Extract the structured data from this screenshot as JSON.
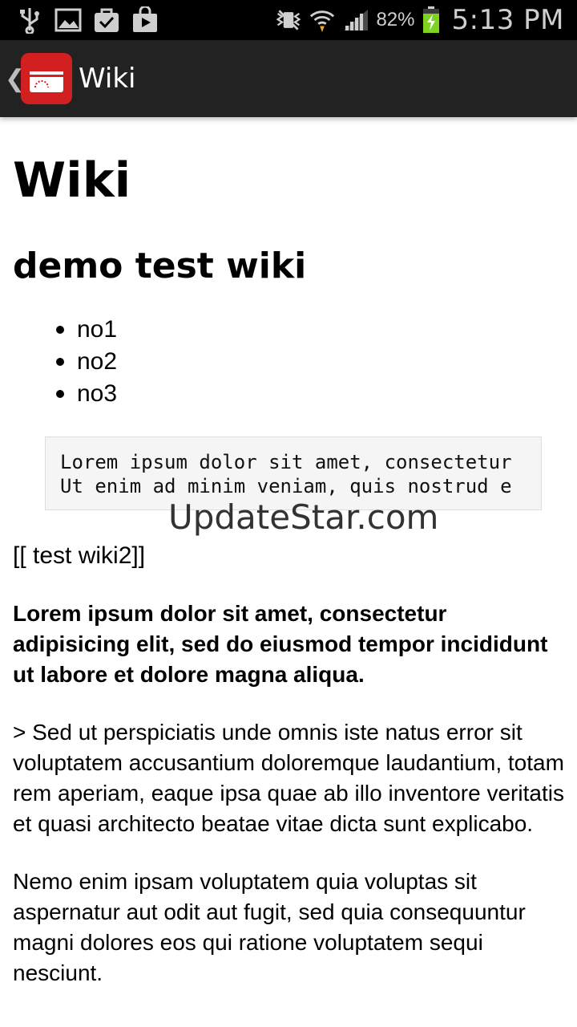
{
  "status_bar": {
    "icons_left": [
      "usb-icon",
      "image-icon",
      "task-icon",
      "store-icon"
    ],
    "icons_right": [
      "mute-icon",
      "wifi-icon",
      "signal-icon"
    ],
    "battery_percent": "82%",
    "time": "5:13 PM",
    "battery_color": "#7ed321"
  },
  "action_bar": {
    "title": "Wiki",
    "app_icon_color": "#d21f1f"
  },
  "content": {
    "h1": "Wiki",
    "h2": "demo test wiki",
    "list": [
      "no1",
      "no2",
      "no3"
    ],
    "code_lines": [
      "Lorem ipsum dolor sit amet, consectetur",
      "Ut enim ad minim veniam, quis nostrud e"
    ],
    "wiki_link": "[[ test wiki2]]",
    "bold_paragraph": "Lorem ipsum dolor sit amet, consectetur adipisicing elit, sed do eiusmod tempor incididunt ut labore et dolore magna aliqua.",
    "quote_paragraph": "> Sed ut perspiciatis unde omnis iste natus error sit voluptatem accusantium doloremque laudantium, totam rem aperiam, eaque ipsa quae ab illo inventore veritatis et quasi architecto beatae vitae dicta sunt explicabo.",
    "paragraph": "Nemo enim ipsam voluptatem quia voluptas sit aspernatur aut odit aut fugit, sed quia consequuntur magni dolores eos qui ratione voluptatem sequi nesciunt."
  },
  "watermark": "UpdateStar.com"
}
